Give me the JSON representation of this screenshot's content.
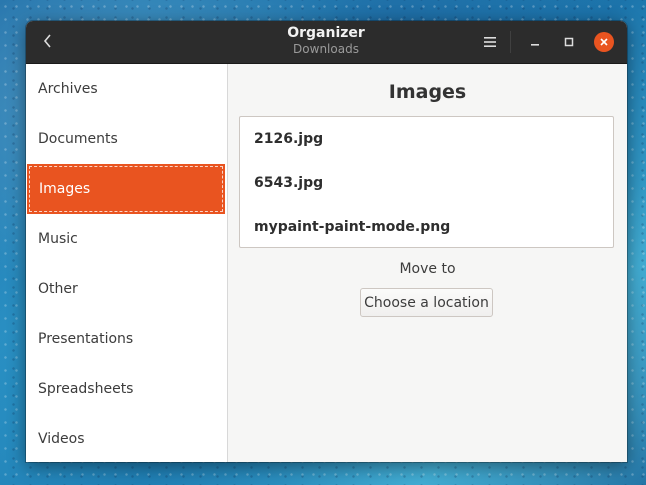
{
  "window": {
    "title": "Organizer",
    "subtitle": "Downloads"
  },
  "headerbar": {
    "back_icon": "chevron-left-icon",
    "menu_icon": "hamburger-menu-icon",
    "minimize_icon": "minimize-icon",
    "maximize_icon": "maximize-icon",
    "close_icon": "close-icon",
    "close_color": "#e95420"
  },
  "sidebar": {
    "items": [
      {
        "label": "Archives",
        "selected": false
      },
      {
        "label": "Documents",
        "selected": false
      },
      {
        "label": "Images",
        "selected": true
      },
      {
        "label": "Music",
        "selected": false
      },
      {
        "label": "Other",
        "selected": false
      },
      {
        "label": "Presentations",
        "selected": false
      },
      {
        "label": "Spreadsheets",
        "selected": false
      },
      {
        "label": "Videos",
        "selected": false
      }
    ],
    "selected_color": "#e95420"
  },
  "main": {
    "section_title": "Images",
    "files": [
      "2126.jpg",
      "6543.jpg",
      "mypaint-paint-mode.png"
    ],
    "move_to_label": "Move to",
    "choose_location_label": "Choose a location"
  }
}
